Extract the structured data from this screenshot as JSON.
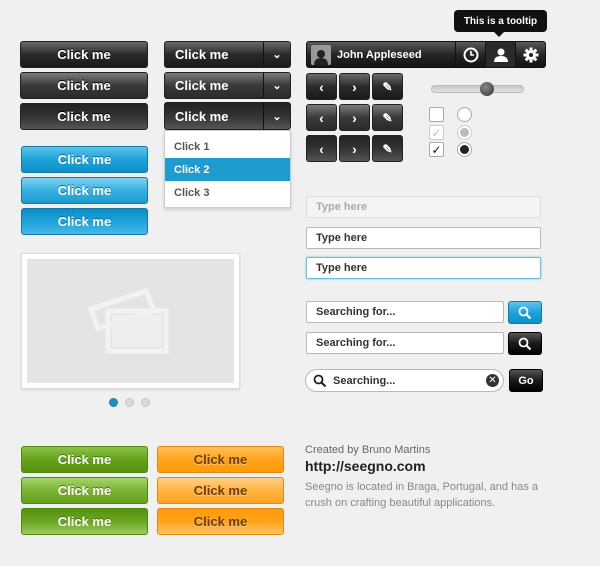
{
  "buttons": {
    "dark": [
      "Click me",
      "Click me",
      "Click me"
    ],
    "blue": [
      "Click me",
      "Click me",
      "Click me"
    ],
    "green": [
      "Click me",
      "Click me",
      "Click me"
    ],
    "orange": [
      "Click me",
      "Click me",
      "Click me"
    ]
  },
  "split_buttons": [
    "Click me",
    "Click me",
    "Click me"
  ],
  "dropdown": {
    "options": [
      "Click 1",
      "Click 2",
      "Click 3"
    ],
    "selected": "Click 2"
  },
  "navbar": {
    "username": "John Appleseed",
    "tooltip": "This is a tooltip"
  },
  "slider": {
    "value_fraction": 0.6
  },
  "checkboxes": [
    {
      "state": "unchecked"
    },
    {
      "state": "checked-disabled"
    },
    {
      "state": "checked"
    }
  ],
  "radios": [
    {
      "state": "unselected"
    },
    {
      "state": "selected-disabled"
    },
    {
      "state": "selected"
    }
  ],
  "inputs": [
    {
      "placeholder": "Type here",
      "state": "disabled"
    },
    {
      "placeholder": "Type here",
      "state": "normal"
    },
    {
      "placeholder": "Type here",
      "state": "focused"
    }
  ],
  "search": [
    {
      "placeholder": "Searching for...",
      "button": "search-blue"
    },
    {
      "placeholder": "Searching for...",
      "button": "search-dark"
    }
  ],
  "search_round": {
    "placeholder": "Searching...",
    "go_label": "Go"
  },
  "carousel": {
    "pages": 3,
    "active": 1
  },
  "credits": {
    "author": "Created by Bruno Martins",
    "url": "http://seegno.com",
    "description_line1": "Seegno is located in Braga, Portugal, and has a",
    "description_line2": "crush on crafting beautiful applications."
  },
  "colors": {
    "accent_blue": "#1e9cd0",
    "green": "#66a11c",
    "orange": "#ffa31a",
    "dark": "#2a2a2a"
  }
}
